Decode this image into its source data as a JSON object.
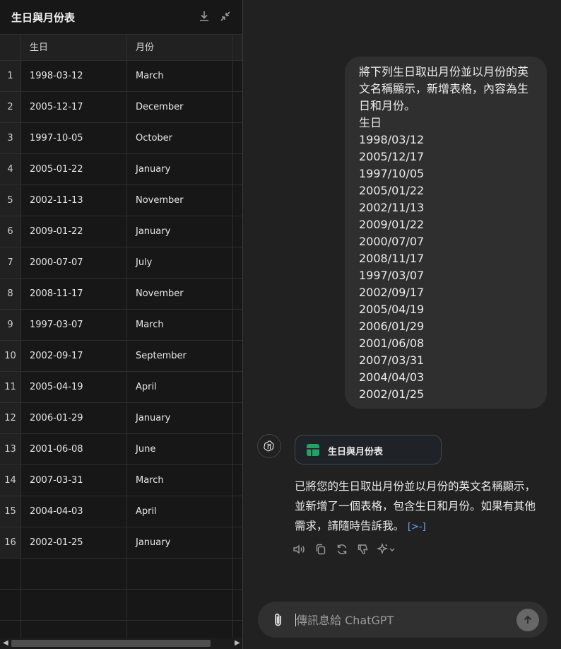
{
  "panel": {
    "title": "生日與月份表",
    "download_icon": "download-icon",
    "collapse_icon": "collapse-icon"
  },
  "table": {
    "headers": [
      "生日",
      "月份"
    ],
    "rows": [
      {
        "n": "1",
        "date": "1998-03-12",
        "month": "March"
      },
      {
        "n": "2",
        "date": "2005-12-17",
        "month": "December"
      },
      {
        "n": "3",
        "date": "1997-10-05",
        "month": "October"
      },
      {
        "n": "4",
        "date": "2005-01-22",
        "month": "January"
      },
      {
        "n": "5",
        "date": "2002-11-13",
        "month": "November"
      },
      {
        "n": "6",
        "date": "2009-01-22",
        "month": "January"
      },
      {
        "n": "7",
        "date": "2000-07-07",
        "month": "July"
      },
      {
        "n": "8",
        "date": "2008-11-17",
        "month": "November"
      },
      {
        "n": "9",
        "date": "1997-03-07",
        "month": "March"
      },
      {
        "n": "10",
        "date": "2002-09-17",
        "month": "September"
      },
      {
        "n": "11",
        "date": "2005-04-19",
        "month": "April"
      },
      {
        "n": "12",
        "date": "2006-01-29",
        "month": "January"
      },
      {
        "n": "13",
        "date": "2001-06-08",
        "month": "June"
      },
      {
        "n": "14",
        "date": "2007-03-31",
        "month": "March"
      },
      {
        "n": "15",
        "date": "2004-04-03",
        "month": "April"
      },
      {
        "n": "16",
        "date": "2002-01-25",
        "month": "January"
      }
    ]
  },
  "user_message": {
    "lines": [
      "將下列生日取出月份並以月份的英",
      "文名稱顯示，新增表格，內容為生",
      "日和月份。",
      "生日",
      "1998/03/12",
      "2005/12/17",
      "1997/10/05",
      "2005/01/22",
      "2002/11/13",
      "2009/01/22",
      "2000/07/07",
      "2008/11/17",
      "1997/03/07",
      "2002/09/17",
      "2005/04/19",
      "2006/01/29",
      "2001/06/08",
      "2007/03/31",
      "2004/04/03",
      "2002/01/25"
    ]
  },
  "assistant": {
    "chip_label": "生日與月份表",
    "answer_lines": [
      "已將您的生日取出月份並以月份的英文名稱顯示，",
      "並新增了一個表格，包含生日和月份。如果有其他",
      "需求，請隨時告訴我。"
    ],
    "cite": "[>-]",
    "actions": [
      "read-aloud-icon",
      "copy-icon",
      "regenerate-icon",
      "thumbs-down-icon",
      "sparkle-icon"
    ]
  },
  "composer": {
    "placeholder": "傳訊息給 ChatGPT"
  },
  "colors": {
    "background": "#212121",
    "panel": "#171717",
    "bubble": "#2f2f2f",
    "chip_icon": "#1fa463",
    "link": "#6ea8ff"
  }
}
